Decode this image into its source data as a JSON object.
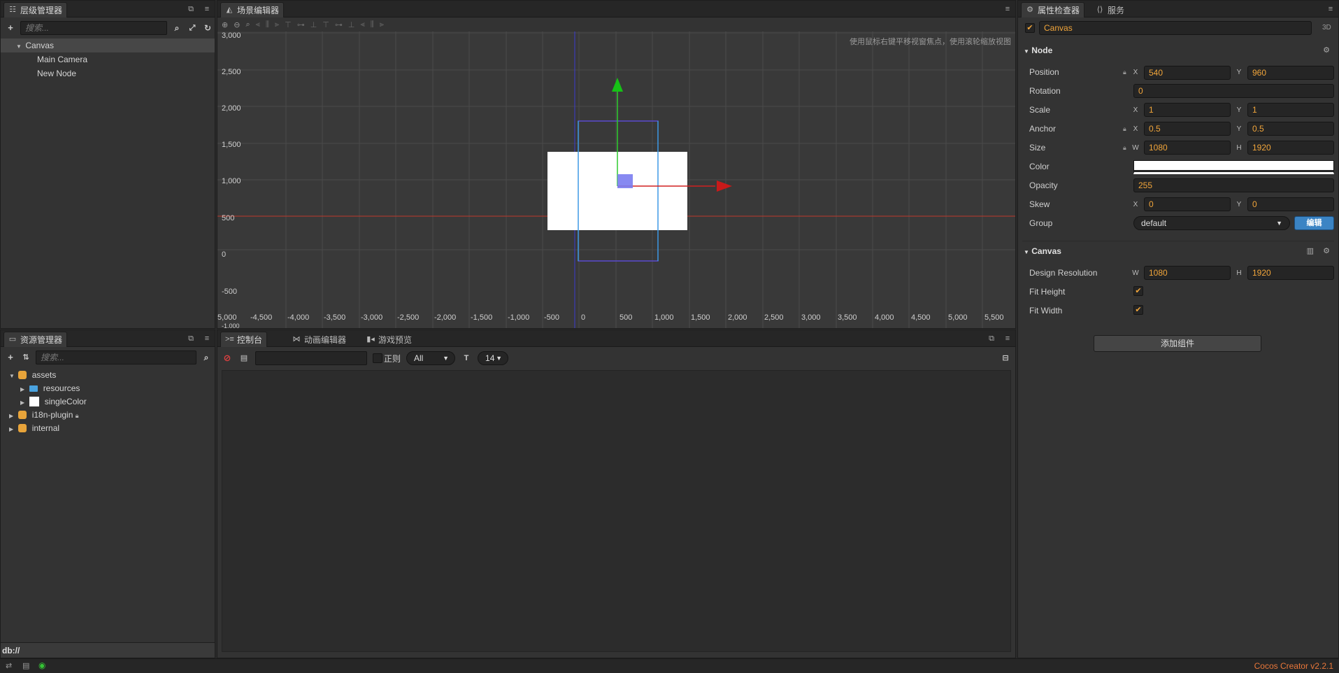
{
  "hierarchy": {
    "tab": "层级管理器",
    "search_placeholder": "搜索...",
    "items": [
      "Canvas",
      "Main Camera",
      "New Node"
    ]
  },
  "assets": {
    "tab": "资源管理器",
    "search_placeholder": "搜索...",
    "items": [
      "assets",
      "resources",
      "singleColor",
      "i18n-plugin",
      "internal"
    ],
    "path": "db://"
  },
  "scene": {
    "tab": "场景编辑器",
    "hint": "使用鼠标右键平移视窗焦点，使用滚轮缩放视图",
    "y_ticks": [
      "3,000",
      "2,500",
      "2,000",
      "1,500",
      "1,000",
      "500",
      "0",
      "-500",
      "-1,000"
    ],
    "x_ticks": [
      "5,000",
      "-4,500",
      "-4,000",
      "-3,500",
      "-3,000",
      "-2,500",
      "-2,000",
      "-1,500",
      "-1,000",
      "-500",
      "0",
      "500",
      "1,000",
      "1,500",
      "2,000",
      "2,500",
      "3,000",
      "3,500",
      "4,000",
      "4,500",
      "5,000",
      "5,500"
    ]
  },
  "console": {
    "tabs": [
      "控制台",
      "动画编辑器",
      "游戏预览"
    ],
    "regex_label": "正则",
    "filter_value": "All",
    "font_size": "14"
  },
  "inspector": {
    "tabs": [
      "属性检查器",
      "服务"
    ],
    "node_name": "Canvas",
    "mode": "3D",
    "node_section": "Node",
    "position_label": "Position",
    "position_x": "540",
    "position_y": "960",
    "rotation_label": "Rotation",
    "rotation": "0",
    "scale_label": "Scale",
    "scale_x": "1",
    "scale_y": "1",
    "anchor_label": "Anchor",
    "anchor_x": "0.5",
    "anchor_y": "0.5",
    "size_label": "Size",
    "size_w": "1080",
    "size_h": "1920",
    "color_label": "Color",
    "opacity_label": "Opacity",
    "opacity": "255",
    "skew_label": "Skew",
    "skew_x": "0",
    "skew_y": "0",
    "group_label": "Group",
    "group": "default",
    "edit_label": "编辑",
    "canvas_section": "Canvas",
    "design_label": "Design Resolution",
    "design_w": "1080",
    "design_h": "1920",
    "fit_height_label": "Fit Height",
    "fit_width_label": "Fit Width",
    "add_component": "添加组件",
    "axis_x": "X",
    "axis_y": "Y",
    "axis_w": "W",
    "axis_h": "H"
  },
  "status": {
    "version": "Cocos Creator v2.2.1"
  },
  "colors": {
    "accent": "#f1a53a",
    "brand": "#e8773a",
    "edit_button": "#3b84c4"
  }
}
